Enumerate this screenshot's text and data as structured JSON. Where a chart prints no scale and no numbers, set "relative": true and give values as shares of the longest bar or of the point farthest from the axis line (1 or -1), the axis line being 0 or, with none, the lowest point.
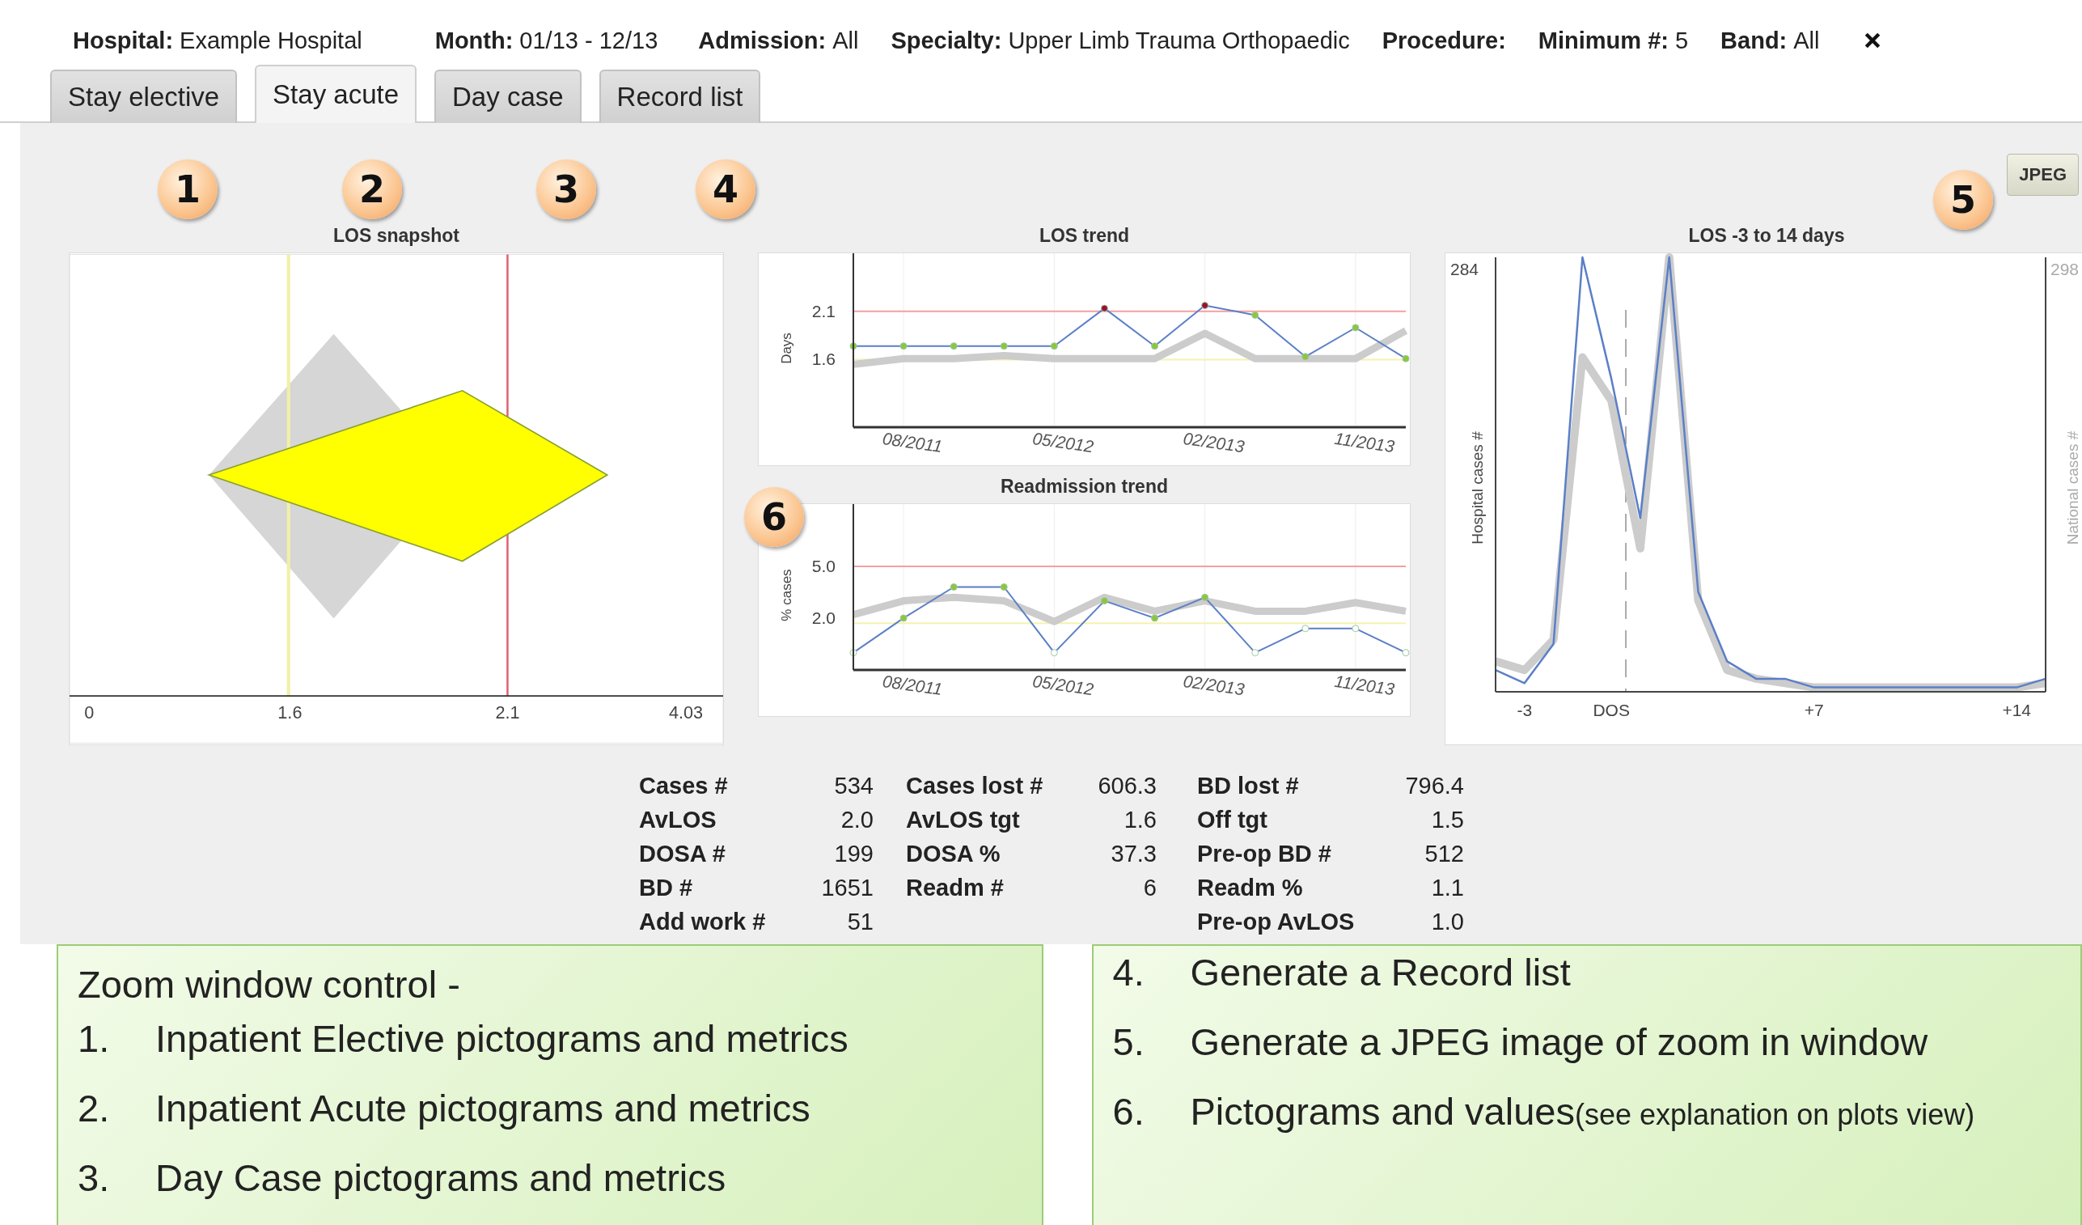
{
  "filters": [
    {
      "label": "Hospital:",
      "value": "Example Hospital"
    },
    {
      "label": "Month:",
      "value": "01/13 - 12/13"
    },
    {
      "label": "Admission:",
      "value": "All"
    },
    {
      "label": "Specialty:",
      "value": "Upper Limb Trauma Orthopaedic"
    },
    {
      "label": "Procedure:"
    },
    {
      "label": "Minimum #:",
      "value": "5"
    },
    {
      "label": "Band:",
      "value": "All"
    }
  ],
  "tabs": [
    {
      "label": "Stay elective",
      "selected": false
    },
    {
      "label": "Stay acute",
      "selected": true
    },
    {
      "label": "Day case",
      "selected": false
    },
    {
      "label": "Record list",
      "selected": false
    }
  ],
  "callouts": [
    "1",
    "2",
    "3",
    "4",
    "5",
    "6"
  ],
  "jpeg_button": "JPEG",
  "snapshot": {
    "title": "LOS snapshot",
    "axis_labels": [
      "0",
      "1.6",
      "2.1",
      "4.03"
    ]
  },
  "los_trend": {
    "title": "LOS trend",
    "chart_data": {
      "type": "line",
      "ylabel": "Days",
      "categories": [
        null,
        "08/2011",
        null,
        null,
        "05/2012",
        null,
        null,
        "02/2013",
        null,
        null,
        "11/2013",
        null
      ],
      "ylim": [
        0.9,
        2.7
      ],
      "yticks": [
        1.6,
        2.1
      ],
      "series": [
        {
          "color": "#cccccc",
          "values": [
            1.55,
            1.61,
            1.61,
            1.64,
            1.61,
            1.61,
            1.61,
            1.87,
            1.61,
            1.61,
            1.61,
            1.9
          ]
        },
        {
          "color": "#5b7fc7",
          "marker": "circle",
          "values": [
            1.74,
            1.74,
            1.74,
            1.74,
            1.74,
            2.13,
            1.74,
            2.16,
            2.06,
            1.63,
            1.93,
            1.61
          ]
        }
      ],
      "ref_lines": [
        {
          "axis": "y",
          "value": 2.1,
          "color": "#f4a0a0"
        },
        {
          "axis": "y",
          "value": 1.6,
          "color": "#f4f2b0"
        }
      ]
    }
  },
  "readmission_trend": {
    "title": "Readmission trend",
    "chart_data": {
      "type": "line",
      "ylabel": "% cases",
      "categories": [
        null,
        "08/2011",
        null,
        null,
        "05/2012",
        null,
        null,
        "02/2013",
        null,
        null,
        "11/2013",
        null
      ],
      "ylim": [
        -1,
        8.6
      ],
      "yticks": [
        {
          "value": 2,
          "label": "2.0"
        },
        {
          "value": 5,
          "label": "5.0"
        }
      ],
      "series": [
        {
          "color": "#cccccc",
          "values": [
            2.2,
            3.0,
            3.2,
            3.0,
            1.8,
            3.2,
            2.4,
            3.0,
            2.4,
            2.4,
            2.9,
            2.4
          ]
        },
        {
          "color": "#5b7fc7",
          "marker": "circle",
          "values": [
            0,
            2.0,
            3.8,
            3.8,
            0,
            3.0,
            2.0,
            3.2,
            0,
            1.4,
            1.4,
            0
          ]
        }
      ],
      "ref_lines": [
        {
          "axis": "y",
          "value": 5,
          "color": "#f4a0a0"
        },
        {
          "axis": "y",
          "value": 1.7,
          "color": "#f4f2b0"
        }
      ]
    }
  },
  "los_days": {
    "title": "LOS -3 to 14 days",
    "top_labels": [
      "284",
      "298"
    ],
    "y2label": "National cases #",
    "chart_data": {
      "type": "line",
      "relative": true,
      "ylabel": "Hospital cases #",
      "x": [
        -4,
        -3,
        -2,
        -1,
        0,
        1,
        2,
        3,
        4,
        5,
        6,
        7,
        8,
        9,
        10,
        11,
        12,
        13,
        14,
        15
      ],
      "xlim": [
        -4,
        15
      ],
      "xticks": [
        {
          "value": -3,
          "label": "-3"
        },
        {
          "value": 0,
          "label": "DOS"
        },
        {
          "value": 7,
          "label": "+7"
        },
        {
          "value": 14,
          "label": "+14"
        }
      ],
      "series": [
        {
          "color": "#cccccc",
          "values": [
            0.07,
            0.05,
            0.12,
            0.77,
            0.67,
            0.33,
            1.0,
            0.21,
            0.05,
            0.03,
            0.02,
            0.01,
            0.01,
            0.01,
            0.01,
            0.01,
            0.01,
            0.01,
            0.01,
            0.02
          ]
        },
        {
          "color": "#5b7fc7",
          "values": [
            0.05,
            0.02,
            0.11,
            1.0,
            0.72,
            0.4,
            1.0,
            0.23,
            0.07,
            0.03,
            0.03,
            0.01,
            0.01,
            0.01,
            0.01,
            0.01,
            0.01,
            0.01,
            0.01,
            0.03
          ]
        }
      ],
      "ref_lines": [
        {
          "axis": "x",
          "value": 0.5,
          "color": "#aaaaaa"
        }
      ]
    }
  },
  "metric_columns": [
    {
      "rows": [
        {
          "label": "Cases #",
          "value": "534"
        },
        {
          "label": "AvLOS",
          "value": "2.0"
        },
        {
          "label": "DOSA #",
          "value": "199"
        },
        {
          "label": "BD #",
          "value": "1651"
        },
        {
          "label": "Add work #",
          "value": "51"
        }
      ]
    },
    {
      "rows": [
        {
          "label": "Cases lost #",
          "value": "606.3"
        },
        {
          "label": "AvLOS tgt",
          "value": "1.6"
        },
        {
          "label": "DOSA %",
          "value": "37.3"
        },
        {
          "label": "Readm #",
          "value": "6"
        }
      ]
    },
    {
      "rows": [
        {
          "label": "BD lost #",
          "value": "796.4"
        },
        {
          "label": "Off tgt",
          "value": "1.5"
        },
        {
          "label": "Pre-op BD #",
          "value": "512"
        },
        {
          "label": "Readm %",
          "value": "1.1"
        },
        {
          "label": "Pre-op AvLOS",
          "value": "1.0"
        }
      ]
    }
  ],
  "notes": [
    {
      "heading": "Zoom window control -",
      "items": [
        {
          "number": "1.",
          "text": "Inpatient Elective pictograms and metrics"
        },
        {
          "number": "2.",
          "text": "Inpatient Acute pictograms and metrics"
        },
        {
          "number": "3.",
          "text": "Day Case pictograms and metrics"
        }
      ]
    },
    {
      "items": [
        {
          "number": "4.",
          "text": "Generate a Record list"
        },
        {
          "number": "5.",
          "text": "Generate a JPEG image of zoom in window"
        },
        {
          "number": "6.",
          "text": "Pictograms and values",
          "note": "(see explanation on plots view)"
        }
      ]
    }
  ]
}
